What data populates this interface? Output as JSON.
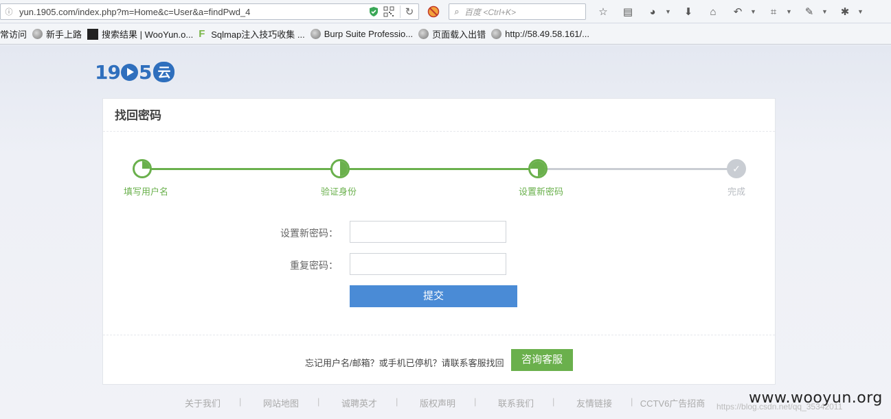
{
  "browser": {
    "url": "yun.1905.com/index.php?m=Home&c=User&a=findPwd_4",
    "search_placeholder": "百度 <Ctrl+K>",
    "bookmarks": [
      {
        "label": "常访问"
      },
      {
        "label": "新手上路"
      },
      {
        "label": "搜索结果 | WooYun.o..."
      },
      {
        "label": "Sqlmap注入技巧收集 ..."
      },
      {
        "label": "Burp Suite Professio..."
      },
      {
        "label": "页面载入出错"
      },
      {
        "label": "http://58.49.58.161/..."
      }
    ]
  },
  "logo": {
    "text_a": "19",
    "text_b": "5",
    "cloud": "云"
  },
  "card": {
    "title": "找回密码",
    "steps": [
      {
        "label": "填写用户名",
        "progress": 0.25
      },
      {
        "label": "验证身份",
        "progress": 0.5
      },
      {
        "label": "设置新密码",
        "progress": 0.75
      },
      {
        "label": "完成",
        "progress": 1.0
      }
    ],
    "form": {
      "new_password_label": "设置新密码：",
      "new_password_value": "",
      "repeat_password_label": "重复密码：",
      "repeat_password_value": "",
      "submit_label": "提交"
    },
    "footer": {
      "text": "忘记用户名/邮箱？或手机已停机？请联系客服找回",
      "service_button": "咨询客服"
    }
  },
  "footer_links": [
    "关于我们",
    "网站地图",
    "诚聘英才",
    "版权声明",
    "联系我们",
    "友情链接",
    "CCTV6广告招商"
  ],
  "watermark": "www.wooyun.org",
  "watermark_small": "https://blog.csdn.net/qq_35342011",
  "colors": {
    "green": "#6ab04c",
    "blue": "#4a8bd6",
    "gray": "#c9cdd3"
  }
}
